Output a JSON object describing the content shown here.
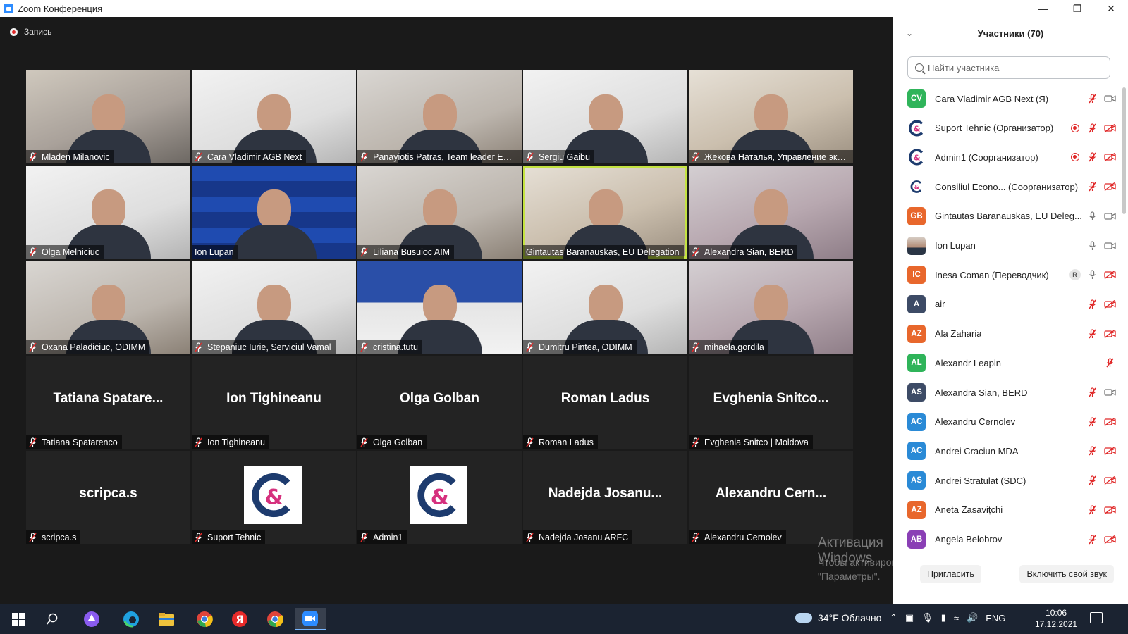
{
  "window": {
    "title": "Zoom Конференция",
    "minimize": "—",
    "restore": "❐",
    "close": "✕"
  },
  "meeting": {
    "recording_label": "Запись",
    "tiles": [
      {
        "name": "Mladen Milanovic",
        "type": "video",
        "style": "v1"
      },
      {
        "name": "Cara Vladimir AGB Next",
        "type": "video",
        "style": "v3"
      },
      {
        "name": "Panayiotis Patras, Team leader EU f...",
        "type": "video",
        "style": "v2"
      },
      {
        "name": "Sergiu Gaibu",
        "type": "video",
        "style": "v3"
      },
      {
        "name": "Жекова Наталья, Управление эко...",
        "type": "video",
        "style": "v4"
      },
      {
        "name": "Olga Melniciuc",
        "type": "video",
        "style": "v3"
      },
      {
        "name": "Ion Lupan",
        "type": "video",
        "style": "blue"
      },
      {
        "name": "Liliana Busuioc AIM",
        "type": "video",
        "style": "v2"
      },
      {
        "name": "Gintautas Baranauskas, EU Delegation",
        "type": "video",
        "style": "v4",
        "active": true
      },
      {
        "name": "Alexandra Sian, BERD",
        "type": "video",
        "style": "v5"
      },
      {
        "name": "Oxana Paladiciuc, ODIMM",
        "type": "video",
        "style": "v2"
      },
      {
        "name": "Stepaniuc Iurie, Serviciul Vamal",
        "type": "video",
        "style": "v3"
      },
      {
        "name": "cristina.tutu",
        "type": "video",
        "style": "bank"
      },
      {
        "name": "Dumitru Pintea, ODIMM",
        "type": "video",
        "style": "v3"
      },
      {
        "name": "mihaela.gordila",
        "type": "video",
        "style": "v5"
      },
      {
        "name": "Tatiana Spatarenco",
        "type": "blank",
        "center": "Tatiana  Spatare..."
      },
      {
        "name": "Ion Tighineanu",
        "type": "blank",
        "center": "Ion Tighineanu"
      },
      {
        "name": "Olga Golban",
        "type": "blank",
        "center": "Olga Golban"
      },
      {
        "name": "Roman Ladus",
        "type": "blank",
        "center": "Roman Ladus"
      },
      {
        "name": "Evghenia Snitco | Moldova",
        "type": "blank",
        "center": "Evghenia  Snitco..."
      },
      {
        "name": "scripca.s",
        "type": "blank",
        "center": "scripca.s"
      },
      {
        "name": "Suport Tehnic",
        "type": "logo"
      },
      {
        "name": "Admin1",
        "type": "logo"
      },
      {
        "name": "Nadejda Josanu ARFC",
        "type": "blank",
        "center": "Nadejda  Josanu..."
      },
      {
        "name": "Alexandru Cernolev",
        "type": "blank",
        "center": "Alexandru  Cern..."
      }
    ],
    "watermark_title": "Активация Windows",
    "watermark_text": "Чтобы активировать Windows, перейдите в раздел \"Параметры\"."
  },
  "participants": {
    "title": "Участники (70)",
    "search_placeholder": "Найти участника",
    "invite_label": "Пригласить",
    "unmute_label": "Включить свой звук",
    "list": [
      {
        "initials": "CV",
        "color": "#2fb45a",
        "name": "Cara Vladimir AGB Next (Я)",
        "rec": false,
        "badge": "",
        "mic": "off",
        "cam": "on"
      },
      {
        "initials": "",
        "color": "logo",
        "name": "Suport Tehnic (Организатор)",
        "rec": true,
        "badge": "",
        "mic": "off",
        "cam": "off"
      },
      {
        "initials": "",
        "color": "logo",
        "name": "Admin1 (Соорганизатор)",
        "rec": true,
        "badge": "",
        "mic": "off",
        "cam": "off"
      },
      {
        "initials": "",
        "color": "logo-small",
        "name": "Consiliul Econo... (Соорганизатор)",
        "rec": false,
        "badge": "",
        "mic": "off",
        "cam": "off"
      },
      {
        "initials": "GB",
        "color": "#e8672c",
        "name": "Gintautas Baranauskas, EU Deleg...",
        "rec": false,
        "badge": "",
        "mic": "on",
        "cam": "on"
      },
      {
        "initials": "",
        "color": "photo",
        "name": "Ion Lupan",
        "rec": false,
        "badge": "",
        "mic": "on",
        "cam": "on"
      },
      {
        "initials": "IC",
        "color": "#e8672c",
        "name": "Inesa Coman (Переводчик)",
        "rec": false,
        "badge": "R",
        "mic": "on",
        "cam": "off"
      },
      {
        "initials": "A",
        "color": "#3d4b66",
        "name": "air",
        "rec": false,
        "badge": "",
        "mic": "off",
        "cam": "off"
      },
      {
        "initials": "AZ",
        "color": "#e8672c",
        "name": "Ala Zaharia",
        "rec": false,
        "badge": "",
        "mic": "off",
        "cam": "off"
      },
      {
        "initials": "AL",
        "color": "#2fb45a",
        "name": "Alexandr Leapin",
        "rec": false,
        "badge": "",
        "mic": "none",
        "cam": "off"
      },
      {
        "initials": "AS",
        "color": "#3d4b66",
        "name": "Alexandra Sian, BERD",
        "rec": false,
        "badge": "",
        "mic": "off",
        "cam": "on"
      },
      {
        "initials": "AC",
        "color": "#2a8ad6",
        "name": "Alexandru Cernolev",
        "rec": false,
        "badge": "",
        "mic": "off",
        "cam": "off"
      },
      {
        "initials": "AC",
        "color": "#2a8ad6",
        "name": "Andrei Craciun MDA",
        "rec": false,
        "badge": "",
        "mic": "off",
        "cam": "off"
      },
      {
        "initials": "AS",
        "color": "#2a8ad6",
        "name": "Andrei Stratulat (SDC)",
        "rec": false,
        "badge": "",
        "mic": "off",
        "cam": "off"
      },
      {
        "initials": "AZ",
        "color": "#e8672c",
        "name": "Aneta Zasavițchi",
        "rec": false,
        "badge": "",
        "mic": "off",
        "cam": "off"
      },
      {
        "initials": "AB",
        "color": "#8a3fb5",
        "name": "Angela Belobrov",
        "rec": false,
        "badge": "",
        "mic": "off",
        "cam": "off"
      }
    ]
  },
  "taskbar": {
    "weather_temp": "34°F",
    "weather_text": "Облачно",
    "lang": "ENG",
    "time": "10:06",
    "date": "17.12.2021",
    "apps": [
      "start-icon",
      "search-icon",
      "cortana-icon",
      "edge-icon",
      "file-explorer-icon",
      "chrome-icon",
      "yandex-icon",
      "chrome-profile-icon",
      "zoom-icon"
    ]
  }
}
